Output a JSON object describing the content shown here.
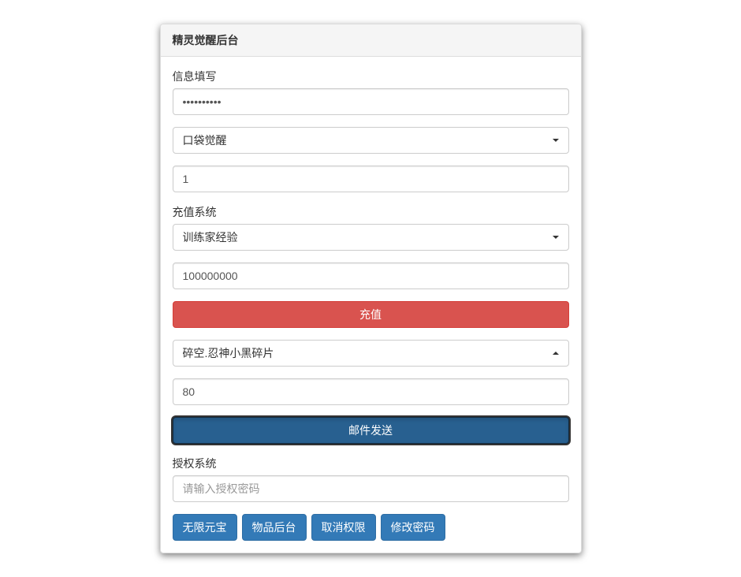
{
  "panel": {
    "title": "精灵觉醒后台"
  },
  "info_section": {
    "label": "信息填写",
    "password_value": "••••••••••",
    "server_select": "口袋觉醒",
    "player_id_value": "1"
  },
  "recharge_section": {
    "label": "充值系统",
    "type_select": "训练家经验",
    "amount_value": "100000000",
    "recharge_button": "充值",
    "item_select": "碎空.忍神小黑碎片",
    "item_qty_value": "80",
    "mail_send_button": "邮件发送"
  },
  "auth_section": {
    "label": "授权系统",
    "auth_placeholder": "请输入授权密码",
    "buttons": {
      "unlimited_gold": "无限元宝",
      "item_admin": "物品后台",
      "revoke_perm": "取消权限",
      "change_pwd": "修改密码"
    }
  }
}
